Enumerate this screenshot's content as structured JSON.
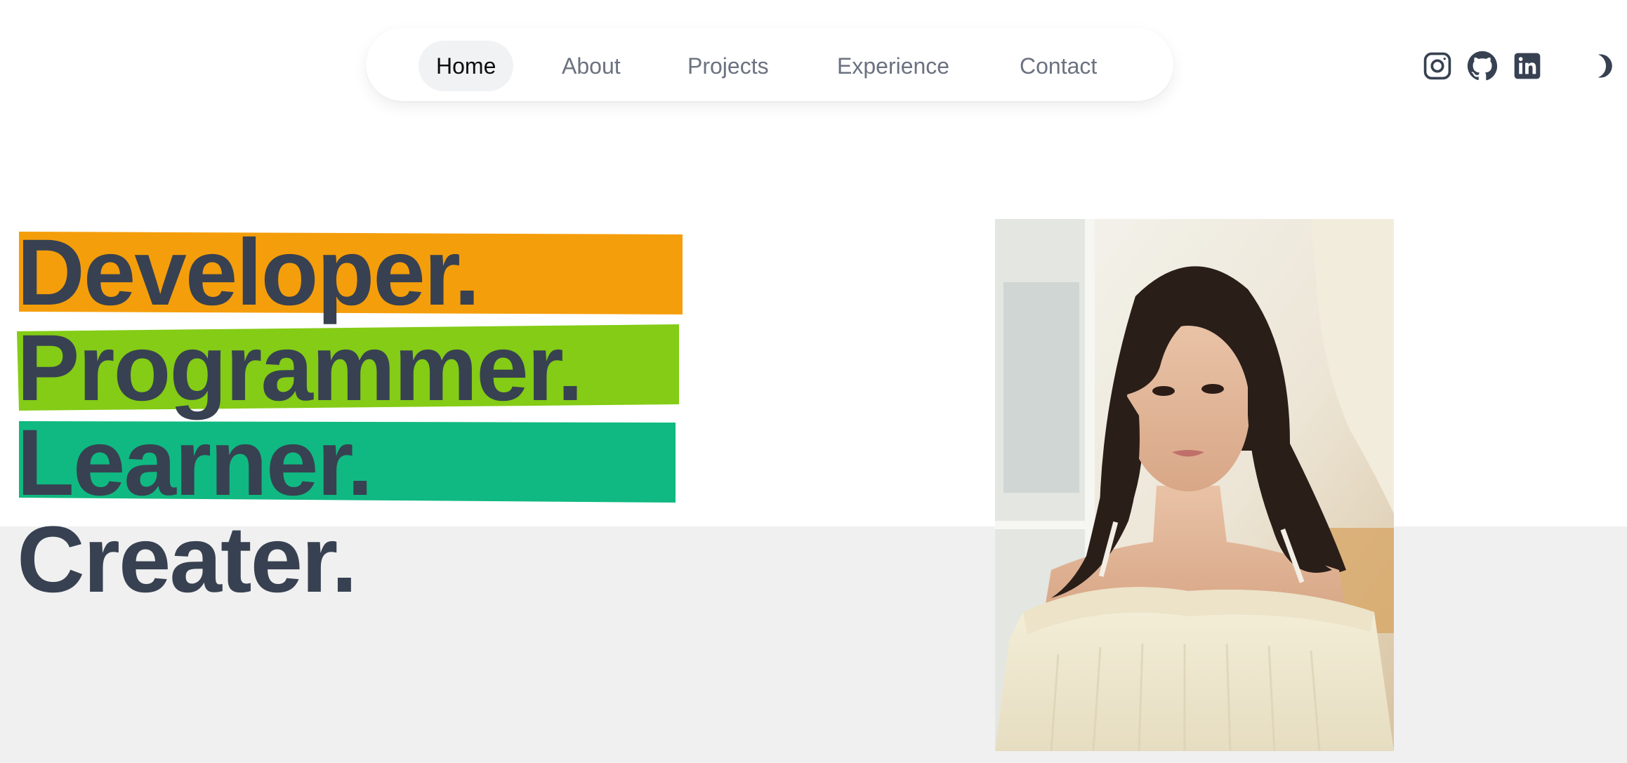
{
  "nav": {
    "items": [
      {
        "label": "Home",
        "active": true
      },
      {
        "label": "About",
        "active": false
      },
      {
        "label": "Projects",
        "active": false
      },
      {
        "label": "Experience",
        "active": false
      },
      {
        "label": "Contact",
        "active": false
      }
    ]
  },
  "social": {
    "icons": [
      "instagram-icon",
      "github-icon",
      "linkedin-icon"
    ],
    "theme_toggle_icon": "moon-icon"
  },
  "hero": {
    "words": [
      {
        "text": "Developer.",
        "highlight": "#f59e0b"
      },
      {
        "text": "Programmer.",
        "highlight": "#84cc16"
      },
      {
        "text": "Learner.",
        "highlight": "#10b981"
      },
      {
        "text": "Creater.",
        "highlight": null
      }
    ],
    "text_color": "#374151",
    "portrait_image": "portrait of a young woman in a cream knit off-shoulder sweater"
  },
  "colors": {
    "nav_text": "#6b7280",
    "nav_active_bg": "#f1f2f4",
    "icon": "#374151",
    "lower_band": "#f0f0f0"
  }
}
